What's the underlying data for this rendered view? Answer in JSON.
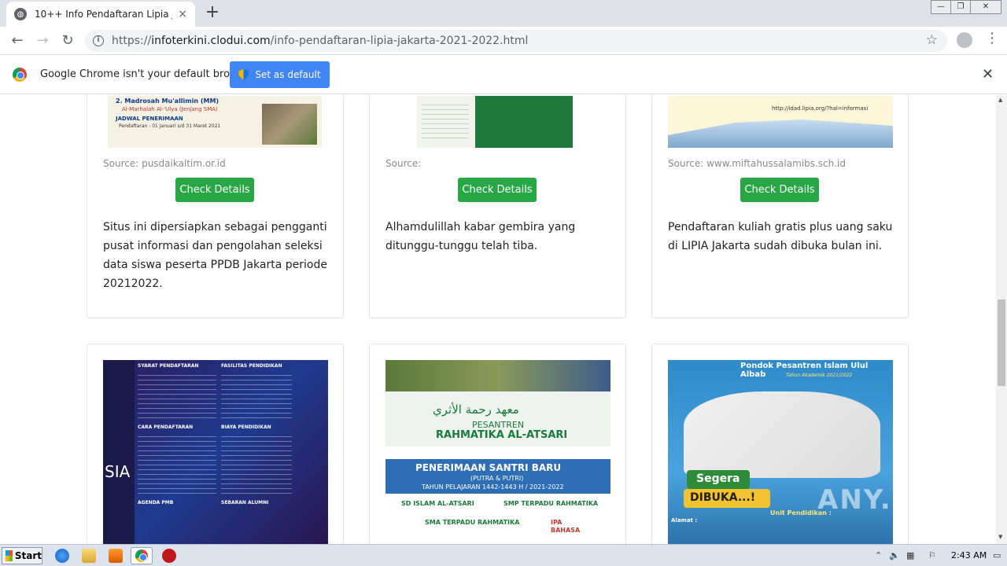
{
  "browser": {
    "tab_title": "10++ Info Pendaftaran Lipia Jakarta",
    "tab_close": "×",
    "new_tab": "+",
    "url_scheme": "https://",
    "url_host": "infoterkini.clodui.com",
    "url_path": "/info-pendaftaran-lipia-jakarta-2021-2022.html",
    "window_minimize": "—",
    "window_restore": "❐",
    "window_close": "✕"
  },
  "infobar": {
    "message": "Google Chrome isn't your default browser",
    "button": "Set as default",
    "close": "✕"
  },
  "cards_top": [
    {
      "source": "Source: pusdaikaltim.or.id",
      "button": "Check Details",
      "description": "Situs ini dipersiapkan sebagai pengganti pusat informasi dan pengolahan seleksi data siswa peserta PPDB Jakarta periode 20212022."
    },
    {
      "source": "Source:",
      "button": "Check Details",
      "description": "Alhamdulillah kabar gembira yang ditunggu-tunggu telah tiba."
    },
    {
      "source": "Source: www.miftahussalamibs.sch.id",
      "button": "Check Details",
      "description": "Pendaftaran kuliah gratis plus uang saku di LIPIA Jakarta sudah dibuka bulan ini."
    }
  ],
  "thumb_text": {
    "t1_line1": "2. Madrosah Mu'allimin (MM)",
    "t1_line2": "Al-Marhalah Al-'Ulya (Jenjang SMA)",
    "t1_line3": "JADWAL PENERIMAAN",
    "t1_line4": "Pendaftaran : 01 Januari s/d 31 Maret 2021",
    "t3_url": "http://idad.lipia.org/?hal=informasi",
    "t4_title1": "SYARAT PENDAFTARAN",
    "t4_title2": "FASILITAS PENDIDIKAN",
    "t4_title3": "CARA PENDAFTARAN",
    "t4_title4": "BIAYA PENDIDIKAN",
    "t4_title5": "AGENDA PMB",
    "t4_title6": "SEBARAN ALUMNI",
    "t4_side": "SIA",
    "t5_arabic": "معهد رحمة الأثري",
    "t5_pesantren": "PESANTREN",
    "t5_name": "RAHMATIKA AL-ATSARI",
    "t5_banner": "PENERIMAAN SANTRI BARU",
    "t5_sub": "(PUTRA & PUTRI)",
    "t5_year": "TAHUN PELAJARAN 1442-1443 H / 2021-2022",
    "t5_sd": "SD ISLAM AL-ATSARI",
    "t5_smp": "SMP TERPADU RAHMATIKA",
    "t5_sma": "SMA TERPADU RAHMATIKA",
    "t5_ipa": "IPA",
    "t5_bahasa": "BAHASA",
    "t6_title": "Pondok Pesantren Islam Ulul Albab",
    "t6_year": "Tahun Akademik 2021/2022",
    "t6_segera": "Segera",
    "t6_dibuka": "DIBUKA...!",
    "t6_alamat": "Alamat :",
    "t6_unit": "Unit Pendidikan :"
  },
  "taskbar": {
    "start": "Start",
    "clock": "2:43 AM"
  },
  "watermark": "ANY.RUN",
  "colors": {
    "button_green": "#28a745",
    "chrome_blue": "#4285f4"
  }
}
